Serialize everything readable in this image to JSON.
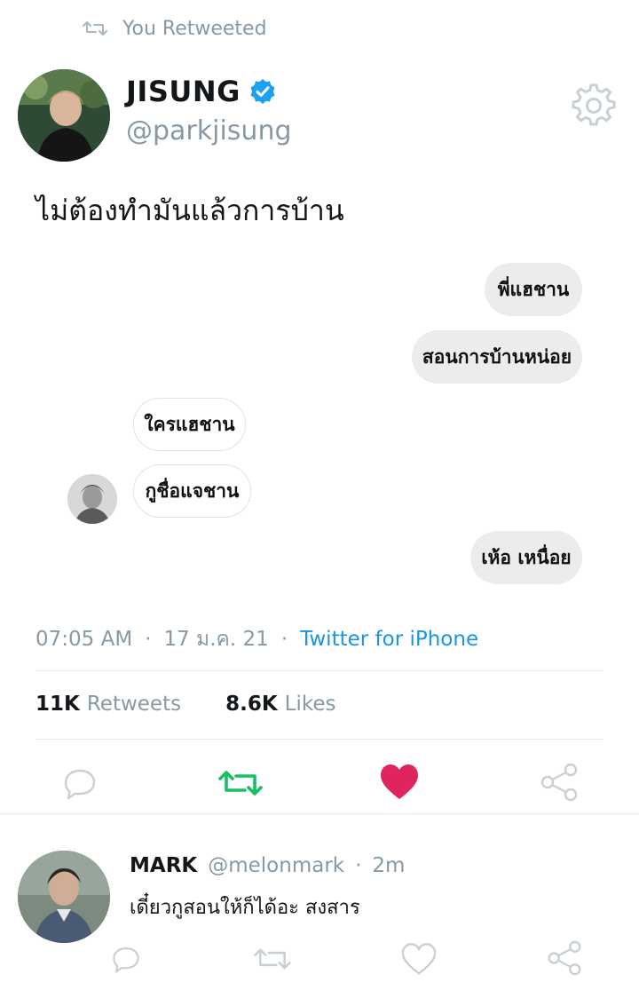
{
  "retweet_header": {
    "label": "You Retweeted"
  },
  "author": {
    "display_name": "JISUNG",
    "handle": "@parkjisung",
    "verified": true
  },
  "tweet": {
    "text": "ไม่ต้องทำมันแล้วการบ้าน",
    "chat": [
      {
        "side": "right",
        "text": "พี่แฮชาน"
      },
      {
        "side": "right",
        "text": "สอนการบ้านหน่อย"
      },
      {
        "side": "left",
        "text": "ใครแฮชาน"
      },
      {
        "side": "left",
        "text": "กูชื่อแจชาน"
      },
      {
        "side": "right",
        "text": "เห้อ เหนื่อย"
      }
    ],
    "time": "07:05 AM",
    "date": "17 ม.ค. 21",
    "sep": "·",
    "source": "Twitter for iPhone"
  },
  "stats": {
    "retweets_count": "11K",
    "retweets_label": "Retweets",
    "likes_count": "8.6K",
    "likes_label": "Likes"
  },
  "actions": {
    "retweeted": true,
    "liked": true
  },
  "reply": {
    "display_name": "MARK",
    "handle": "@melonmark",
    "sep": "·",
    "time": "2m",
    "text": "เดี๋ยวกูสอนให้ก็ได้อะ สงสาร"
  },
  "colors": {
    "accent_blue": "#1b95e0",
    "retweet_green": "#17bf63",
    "like_red": "#e0245e",
    "muted": "#8899a6"
  }
}
